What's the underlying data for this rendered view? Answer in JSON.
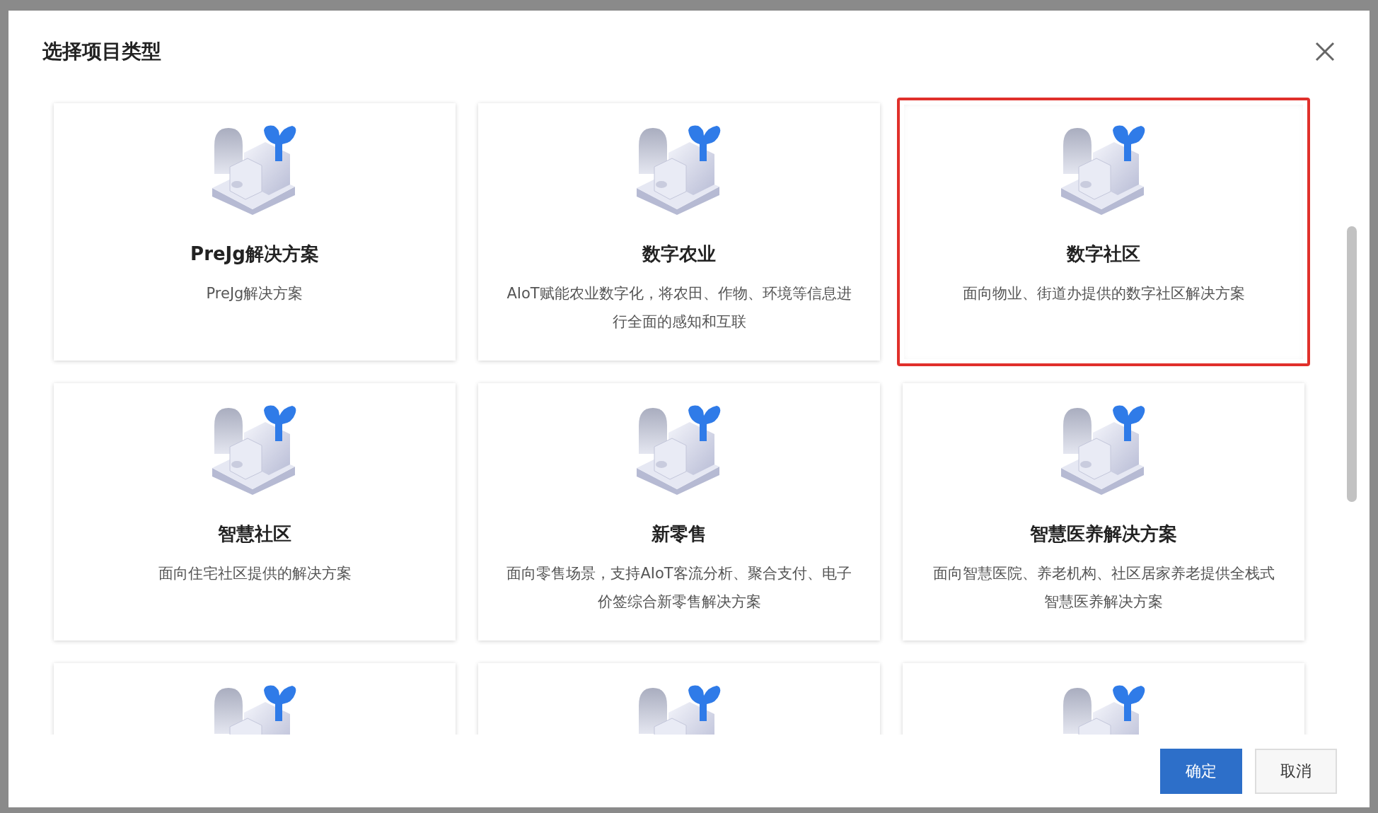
{
  "dialog": {
    "title": "选择项目类型"
  },
  "cards": [
    {
      "title": "PreJg解决方案",
      "description": "PreJg解决方案",
      "selected": false
    },
    {
      "title": "数字农业",
      "description": "AIoT赋能农业数字化，将农田、作物、环境等信息进行全面的感知和互联",
      "selected": false
    },
    {
      "title": "数字社区",
      "description": "面向物业、街道办提供的数字社区解决方案",
      "selected": true
    },
    {
      "title": "智慧社区",
      "description": "面向住宅社区提供的解决方案",
      "selected": false
    },
    {
      "title": "新零售",
      "description": "面向零售场景，支持AIoT客流分析、聚合支付、电子价签综合新零售解决方案",
      "selected": false
    },
    {
      "title": "智慧医养解决方案",
      "description": "面向智慧医院、养老机构、社区居家养老提供全栈式智慧医养解决方案",
      "selected": false
    },
    {
      "selected": false
    },
    {
      "selected": false
    },
    {
      "selected": false
    }
  ],
  "buttons": [
    {
      "label": "确定",
      "kind": "primary"
    },
    {
      "label": "取消",
      "kind": "default"
    }
  ]
}
